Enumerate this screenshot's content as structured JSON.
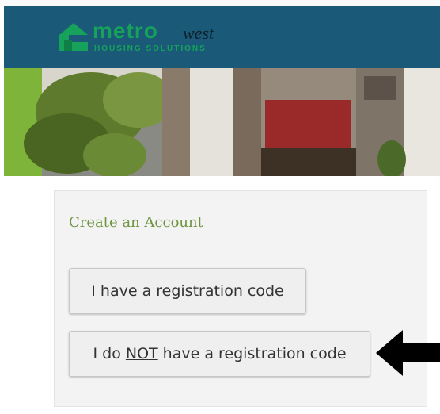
{
  "header": {
    "logo": {
      "brand_metro": "metro",
      "brand_west": "west",
      "tagline": "HOUSING SOLUTIONS"
    },
    "colors": {
      "background": "#1a5a78",
      "brand_green": "#16a25a"
    }
  },
  "banner": {
    "description_icon": "building-photo"
  },
  "card": {
    "title": "Create an Account",
    "buttons": {
      "has_code": "I have a registration code",
      "no_code_prefix": "I do ",
      "no_code_emphasis": "NOT",
      "no_code_suffix": " have a registration code"
    }
  },
  "annotation": {
    "icon": "black-arrow-left-icon"
  }
}
